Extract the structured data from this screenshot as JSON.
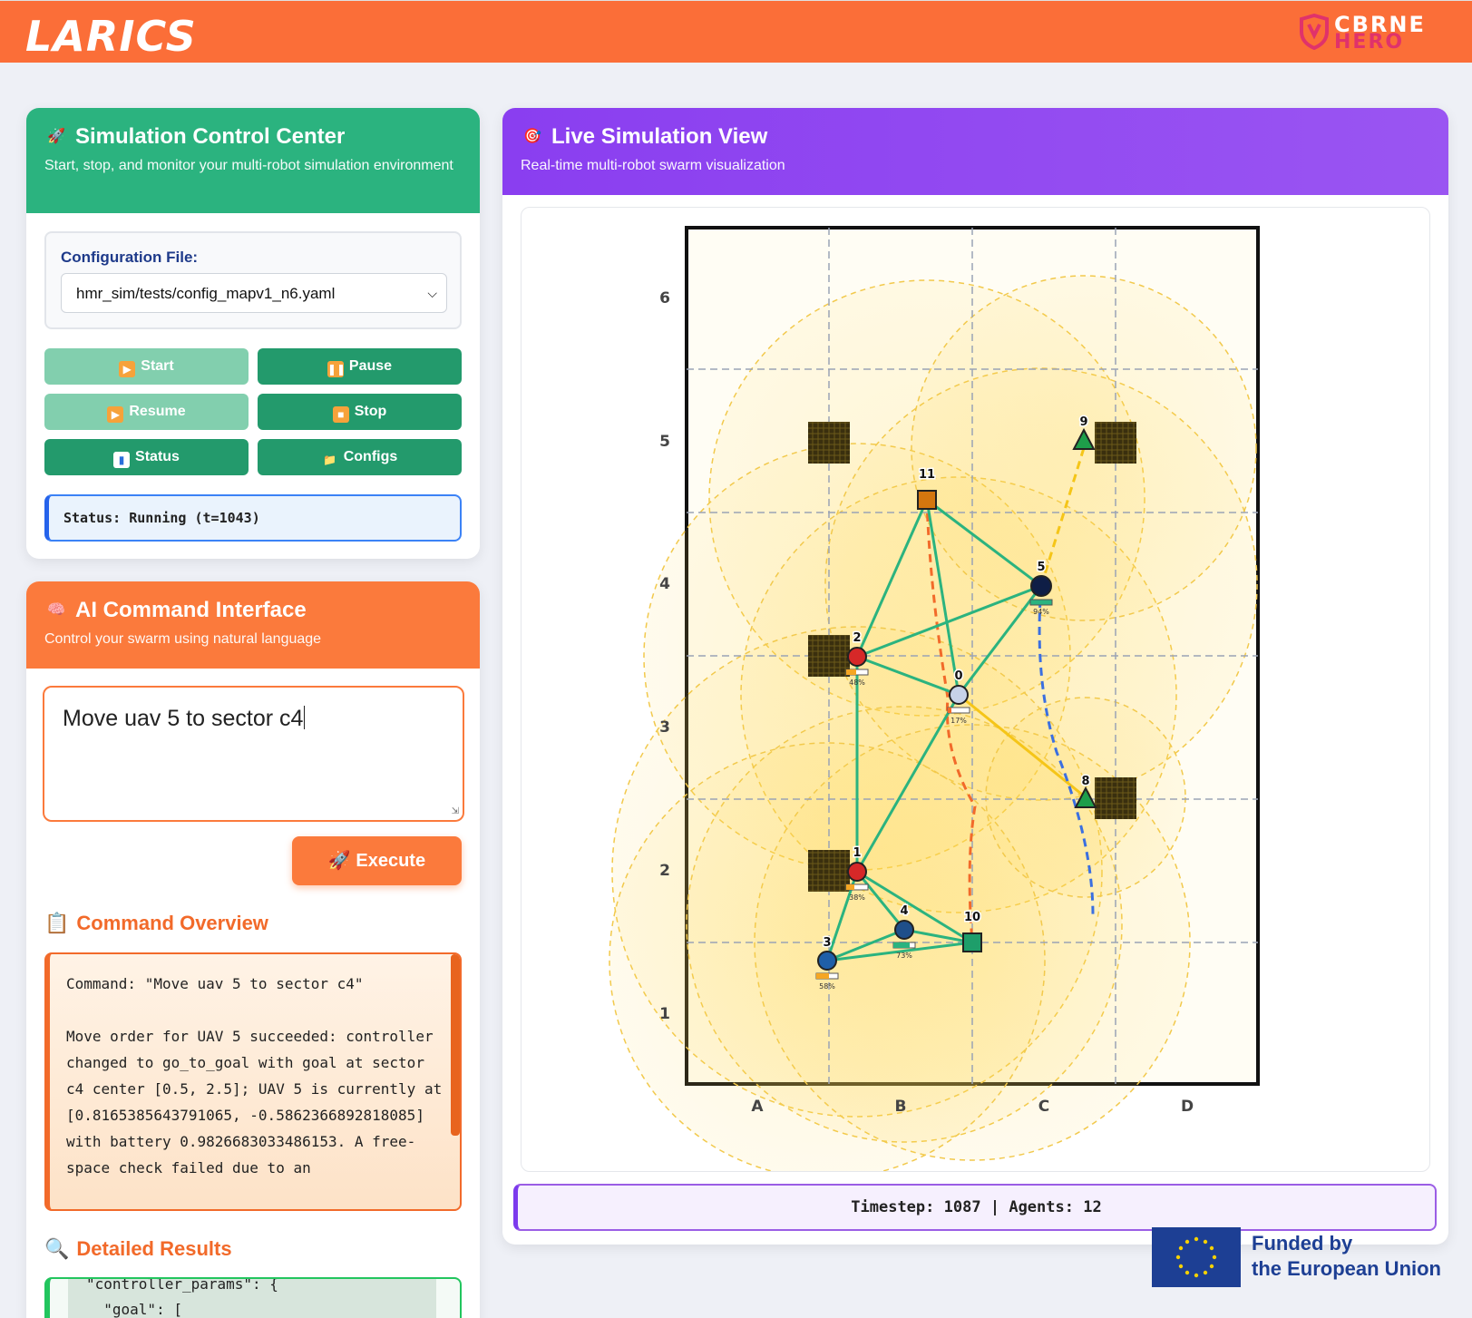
{
  "header": {
    "brand_left": "LARICS",
    "brand_right_top": "CBRNE",
    "brand_right_bottom": "HERO"
  },
  "control_center": {
    "icon": "rocket-icon",
    "title": "Simulation Control Center",
    "subtitle": "Start, stop, and monitor your multi-robot simulation environment",
    "config_label": "Configuration File:",
    "config_value": "hmr_sim/tests/config_mapv1_n6.yaml",
    "buttons": {
      "start": "Start",
      "pause": "Pause",
      "resume": "Resume",
      "stop": "Stop",
      "status": "Status",
      "configs": "Configs"
    },
    "status_text": "Status: Running (t=1043)"
  },
  "ai_interface": {
    "icon": "brain-icon",
    "title": "AI Command Interface",
    "subtitle": "Control your swarm using natural language",
    "command_input": "Move uav 5 to sector c4",
    "execute_label": "Execute",
    "overview_title": "Command Overview",
    "overview_text": "Command: \"Move uav 5 to sector c4\"\n\nMove order for UAV 5 succeeded: controller changed to go_to_goal with goal at sector c4 center [0.5, 2.5]; UAV 5 is currently at [0.8165385643791065, -0.5862366892818085] with battery 0.9826683033486153. A free-space check failed due to an",
    "results_title": "Detailed Results",
    "results_text": "\"controller_params\": {\n  \"goal\": ["
  },
  "sim_view": {
    "icon": "target-icon",
    "title": "Live Simulation View",
    "subtitle": "Real-time multi-robot swarm visualization",
    "col_labels": [
      "A",
      "B",
      "C",
      "D"
    ],
    "row_labels": [
      "6",
      "5",
      "4",
      "3",
      "2",
      "1"
    ],
    "agents": [
      {
        "id": "0",
        "kind": "ugv",
        "color": "#c7d2e8",
        "battery": "17%"
      },
      {
        "id": "1",
        "kind": "ugv",
        "color": "#d62828",
        "battery": "38%"
      },
      {
        "id": "2",
        "kind": "ugv",
        "color": "#d62828",
        "battery": "48%"
      },
      {
        "id": "3",
        "kind": "ugv",
        "color": "#1f5fa8",
        "battery": "58%"
      },
      {
        "id": "4",
        "kind": "ugv",
        "color": "#1f4f8a",
        "battery": "73%"
      },
      {
        "id": "5",
        "kind": "uav",
        "color": "#0f1e46",
        "battery": "94%"
      },
      {
        "id": "8",
        "kind": "tri",
        "color": "#1e9e4a",
        "battery": ""
      },
      {
        "id": "9",
        "kind": "tri",
        "color": "#1e9e4a",
        "battery": ""
      },
      {
        "id": "10",
        "kind": "sq",
        "color": "#1e9e6a",
        "battery": ""
      },
      {
        "id": "11",
        "kind": "sq",
        "color": "#d4760e",
        "battery": ""
      }
    ],
    "timestep_label": "Timestep:",
    "timestep_value": "1087",
    "agents_label": "Agents:",
    "agents_value": "12"
  },
  "footer": {
    "eu_line1": "Funded by",
    "eu_line2": "the European Union"
  },
  "colors": {
    "header": "#fb6e38",
    "control_green": "#2bb37f",
    "ai_orange": "#fb7a3c",
    "sim_purple": "#8a3ef0",
    "link_green": "#2bb37f",
    "path_orange": "#f26a2a",
    "path_yellow": "#f5c518",
    "path_blue": "#3b6fe0"
  }
}
